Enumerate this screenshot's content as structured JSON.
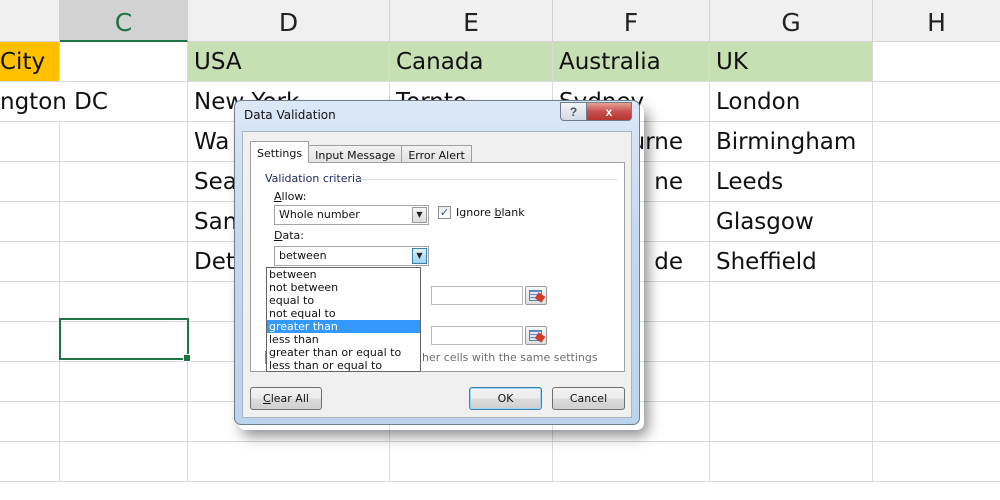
{
  "spreadsheet": {
    "columns": [
      {
        "letter": ""
      },
      {
        "letter": "C"
      },
      {
        "letter": "D"
      },
      {
        "letter": "E"
      },
      {
        "letter": "F"
      },
      {
        "letter": "G"
      },
      {
        "letter": "H"
      }
    ],
    "active_column": "C",
    "header_row": {
      "b": "City",
      "d": "USA",
      "e": "Canada",
      "f": "Australia",
      "g": "UK"
    },
    "rows": [
      {
        "b": "ngton DC",
        "d": "New York",
        "e": "Tornto",
        "f": "Sydney",
        "g": "London"
      },
      {
        "b": "",
        "d": "Wa",
        "e": "",
        "f": "urne",
        "g": "Birmingham"
      },
      {
        "b": "",
        "d": "Sea",
        "e": "",
        "f": "ne",
        "g": "Leeds"
      },
      {
        "b": "",
        "d": "San",
        "e": "",
        "f": "",
        "g": "Glasgow"
      },
      {
        "b": "",
        "d": "Det",
        "e": "",
        "f": "de",
        "g": "Sheffield"
      }
    ],
    "colors": {
      "header_orange": "#ffc000",
      "header_green": "#c6e0b4",
      "selection": "#217346"
    }
  },
  "dialog": {
    "title": "Data Validation",
    "help_button": "?",
    "close_button": "x",
    "tabs": [
      {
        "label": "Settings",
        "active": true
      },
      {
        "label": "Input Message",
        "active": false
      },
      {
        "label": "Error Alert",
        "active": false
      }
    ],
    "group_label": "Validation criteria",
    "allow_label_mnemonic": "A",
    "allow_label_rest": "llow:",
    "allow_value": "Whole number",
    "ignore_blank_checked": true,
    "ignore_blank_pre": "Ignore ",
    "ignore_blank_mnemonic": "b",
    "ignore_blank_post": "lank",
    "data_label_mnemonic": "D",
    "data_label_rest": "ata:",
    "data_value": "between",
    "data_options": [
      "between",
      "not between",
      "equal to",
      "not equal to",
      "greater than",
      "less than",
      "greater than or equal to",
      "less than or equal to"
    ],
    "data_highlighted": "greater than",
    "apply_text": "her cells with the same settings",
    "clear_all_mnemonic": "C",
    "clear_all_rest": "lear All",
    "ok_label": "OK",
    "cancel_label": "Cancel"
  }
}
